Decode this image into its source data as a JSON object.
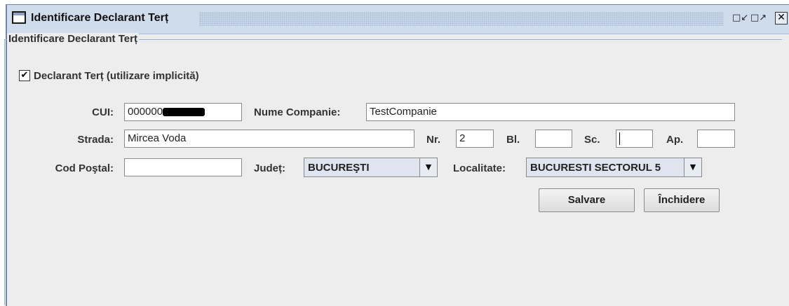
{
  "window": {
    "title": "Identificare Declarant Terț",
    "icons": {
      "app": "window-icon",
      "minimize": "minimize-icon",
      "maximize": "maximize-icon",
      "close": "close-icon"
    }
  },
  "group": {
    "title": "Identificare Declarant Terț"
  },
  "checkbox": {
    "label": "Declarant Terț (utilizare implicită)",
    "checked": true
  },
  "labels": {
    "cui": "CUI:",
    "company": "Nume Companie:",
    "street": "Strada:",
    "nr": "Nr.",
    "bl": "Bl.",
    "sc": "Sc.",
    "ap": "Ap.",
    "postal": "Cod Poştal:",
    "county": "Județ:",
    "locality": "Localitate:"
  },
  "fields": {
    "cui": "000000",
    "company": "TestCompanie",
    "street": "Mircea Voda",
    "nr": "2",
    "bl": "",
    "sc": "",
    "ap": "",
    "postal": ""
  },
  "combos": {
    "county": "BUCUREŞTI",
    "locality": "BUCURESTI SECTORUL 5"
  },
  "buttons": {
    "save": "Salvare",
    "close": "Închidere"
  }
}
